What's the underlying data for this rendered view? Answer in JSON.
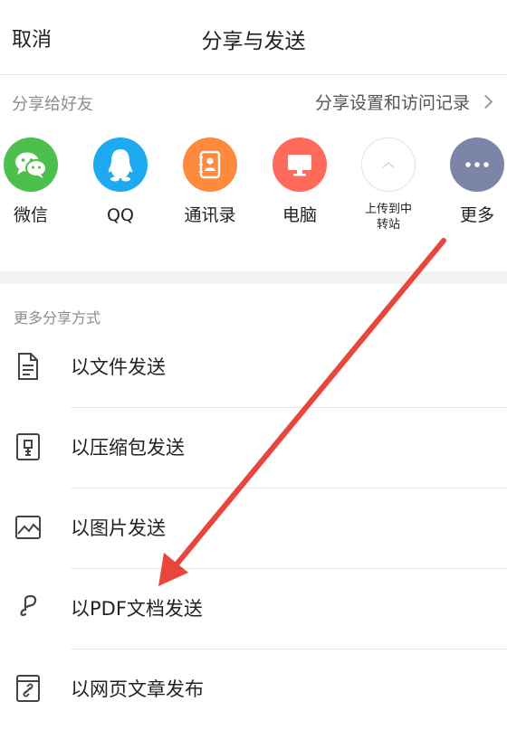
{
  "header": {
    "cancel_label": "取消",
    "title": "分享与发送"
  },
  "share_bar": {
    "label": "分享给好友",
    "settings_label": "分享设置和访问记录"
  },
  "friends": [
    {
      "label": "微信",
      "icon": "wechat-icon",
      "color": "#4cbf4c"
    },
    {
      "label": "QQ",
      "icon": "qq-icon",
      "color": "#1eaaf1"
    },
    {
      "label": "通讯录",
      "icon": "contacts-icon",
      "color": "#ff8a3d"
    },
    {
      "label": "电脑",
      "icon": "computer-icon",
      "color": "#ff6a5b"
    },
    {
      "label": "上传到中转站",
      "icon": "upload-transfer-icon",
      "color": "#ffffff"
    },
    {
      "label": "更多",
      "icon": "more-icon",
      "color": "#7c85a8"
    }
  ],
  "more_section": {
    "title": "更多分享方式",
    "options": [
      {
        "label": "以文件发送",
        "icon": "document-icon"
      },
      {
        "label": "以压缩包发送",
        "icon": "archive-icon"
      },
      {
        "label": "以图片发送",
        "icon": "image-icon"
      },
      {
        "label": "以PDF文档发送",
        "icon": "pdf-icon"
      },
      {
        "label": "以网页文章发布",
        "icon": "webpage-icon"
      }
    ]
  },
  "annotation": {
    "arrow_color": "#e8453c"
  }
}
